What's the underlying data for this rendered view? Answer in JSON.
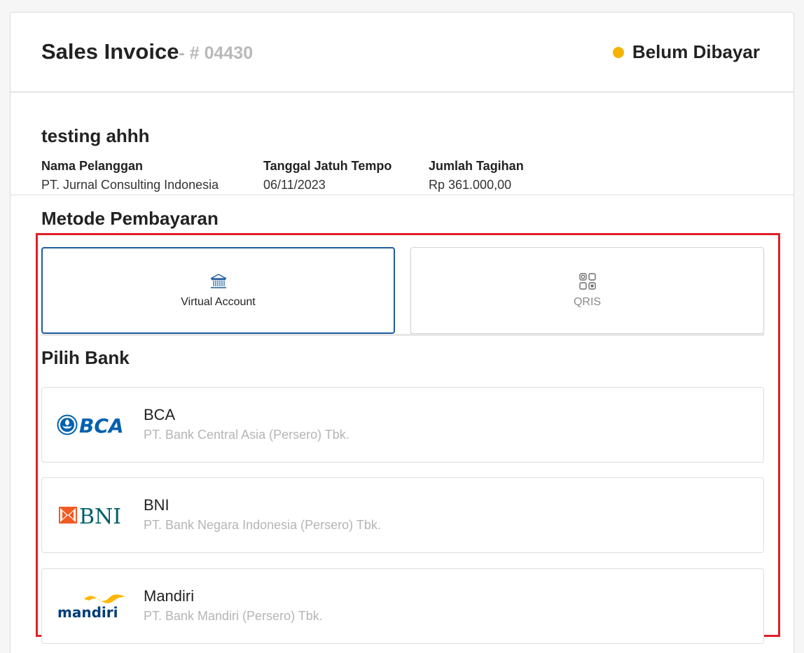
{
  "invoice": {
    "title": "Sales Invoice",
    "number": "- # 04430",
    "status": "Belum Dibayar",
    "status_color": "#f5b400"
  },
  "customer": {
    "heading": "testing ahhh",
    "fields": [
      {
        "label": "Nama Pelanggan",
        "value": "PT. Jurnal Consulting Indonesia"
      },
      {
        "label": "Tanggal Jatuh Tempo",
        "value": "06/11/2023"
      },
      {
        "label": "Jumlah Tagihan",
        "value": "Rp 361.000,00"
      }
    ]
  },
  "payment": {
    "title": "Metode Pembayaran",
    "options": [
      {
        "label": "Virtual Account",
        "icon": "bank-icon",
        "selected": true
      },
      {
        "label": "QRIS",
        "icon": "qr-code-icon",
        "selected": false
      }
    ],
    "accent_color": "#1f5c9e"
  },
  "banks": {
    "title": "Pilih Bank",
    "items": [
      {
        "name": "BCA",
        "description": "PT. Bank Central Asia (Persero) Tbk.",
        "logo": "bca-logo"
      },
      {
        "name": "BNI",
        "description": "PT. Bank Negara Indonesia (Persero) Tbk.",
        "logo": "bni-logo"
      },
      {
        "name": "Mandiri",
        "description": "PT. Bank Mandiri (Persero) Tbk.",
        "logo": "mandiri-logo"
      }
    ]
  },
  "highlight_color": "#e01f26"
}
